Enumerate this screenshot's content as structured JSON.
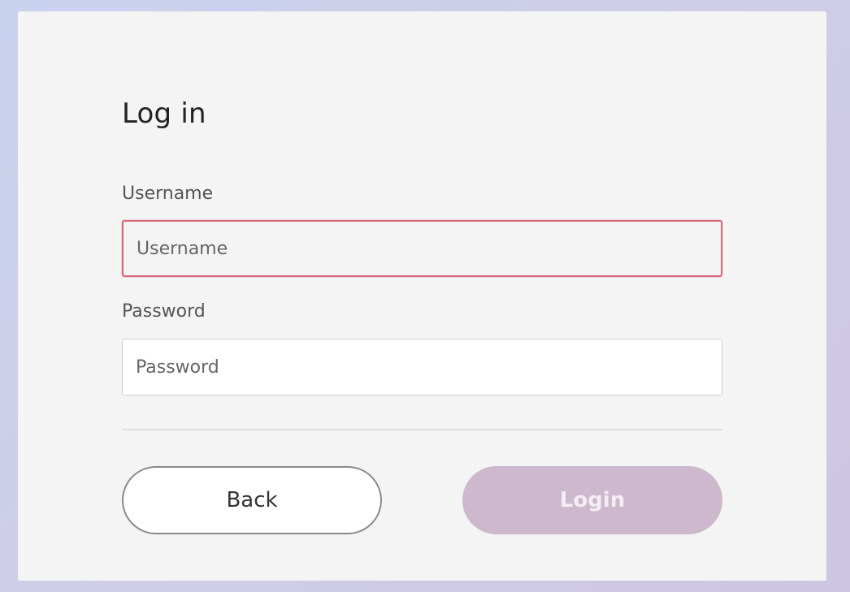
{
  "form": {
    "title": "Log in",
    "username_label": "Username",
    "username_placeholder": "Username",
    "username_value": "",
    "password_label": "Password",
    "password_placeholder": "Password",
    "password_value": ""
  },
  "actions": {
    "back_label": "Back",
    "login_label": "Login"
  },
  "colors": {
    "focus_border": "#d96a7b",
    "login_button": "#cdb8cd",
    "card_background": "#f4f4f4"
  }
}
